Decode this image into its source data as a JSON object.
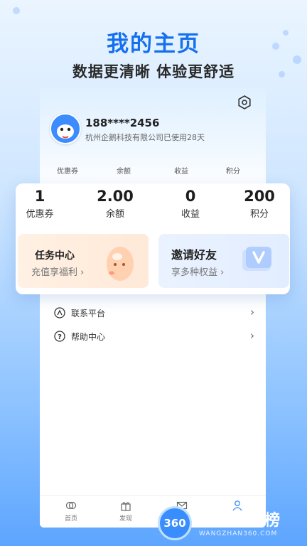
{
  "headline": {
    "title": "我的主页",
    "subtitle": "数据更清晰 体验更舒适"
  },
  "profile": {
    "phone": "188****2456",
    "org_line": "杭州企鹅科技有限公司已使用28天"
  },
  "mini_stats": [
    "优惠券",
    "余额",
    "收益",
    "积分"
  ],
  "stats": [
    {
      "value": "1",
      "label": "优惠券"
    },
    {
      "value": "2.00",
      "label": "余额"
    },
    {
      "value": "0",
      "label": "收益"
    },
    {
      "value": "200",
      "label": "积分"
    }
  ],
  "cards": {
    "task": {
      "title": "任务中心",
      "subtitle": "充值享福利 ›"
    },
    "invite": {
      "title": "邀请好友",
      "subtitle": "享多种权益 ›"
    }
  },
  "menu": [
    {
      "label": "联系平台",
      "icon": "contact-icon"
    },
    {
      "label": "帮助中心",
      "icon": "help-icon"
    }
  ],
  "tabs": [
    {
      "label": "首页",
      "icon": "home-icon"
    },
    {
      "label": "发现",
      "icon": "gift-icon"
    },
    {
      "label": "",
      "icon": "mail-icon"
    },
    {
      "label": "",
      "icon": "profile-icon"
    }
  ],
  "watermark": {
    "badge": "360",
    "text": "网站排行榜",
    "sub": "WANGZHAN360.COM"
  },
  "colors": {
    "accent": "#1570ef",
    "task_bg": "#fff1e4",
    "invite_bg": "#eaf2ff"
  }
}
